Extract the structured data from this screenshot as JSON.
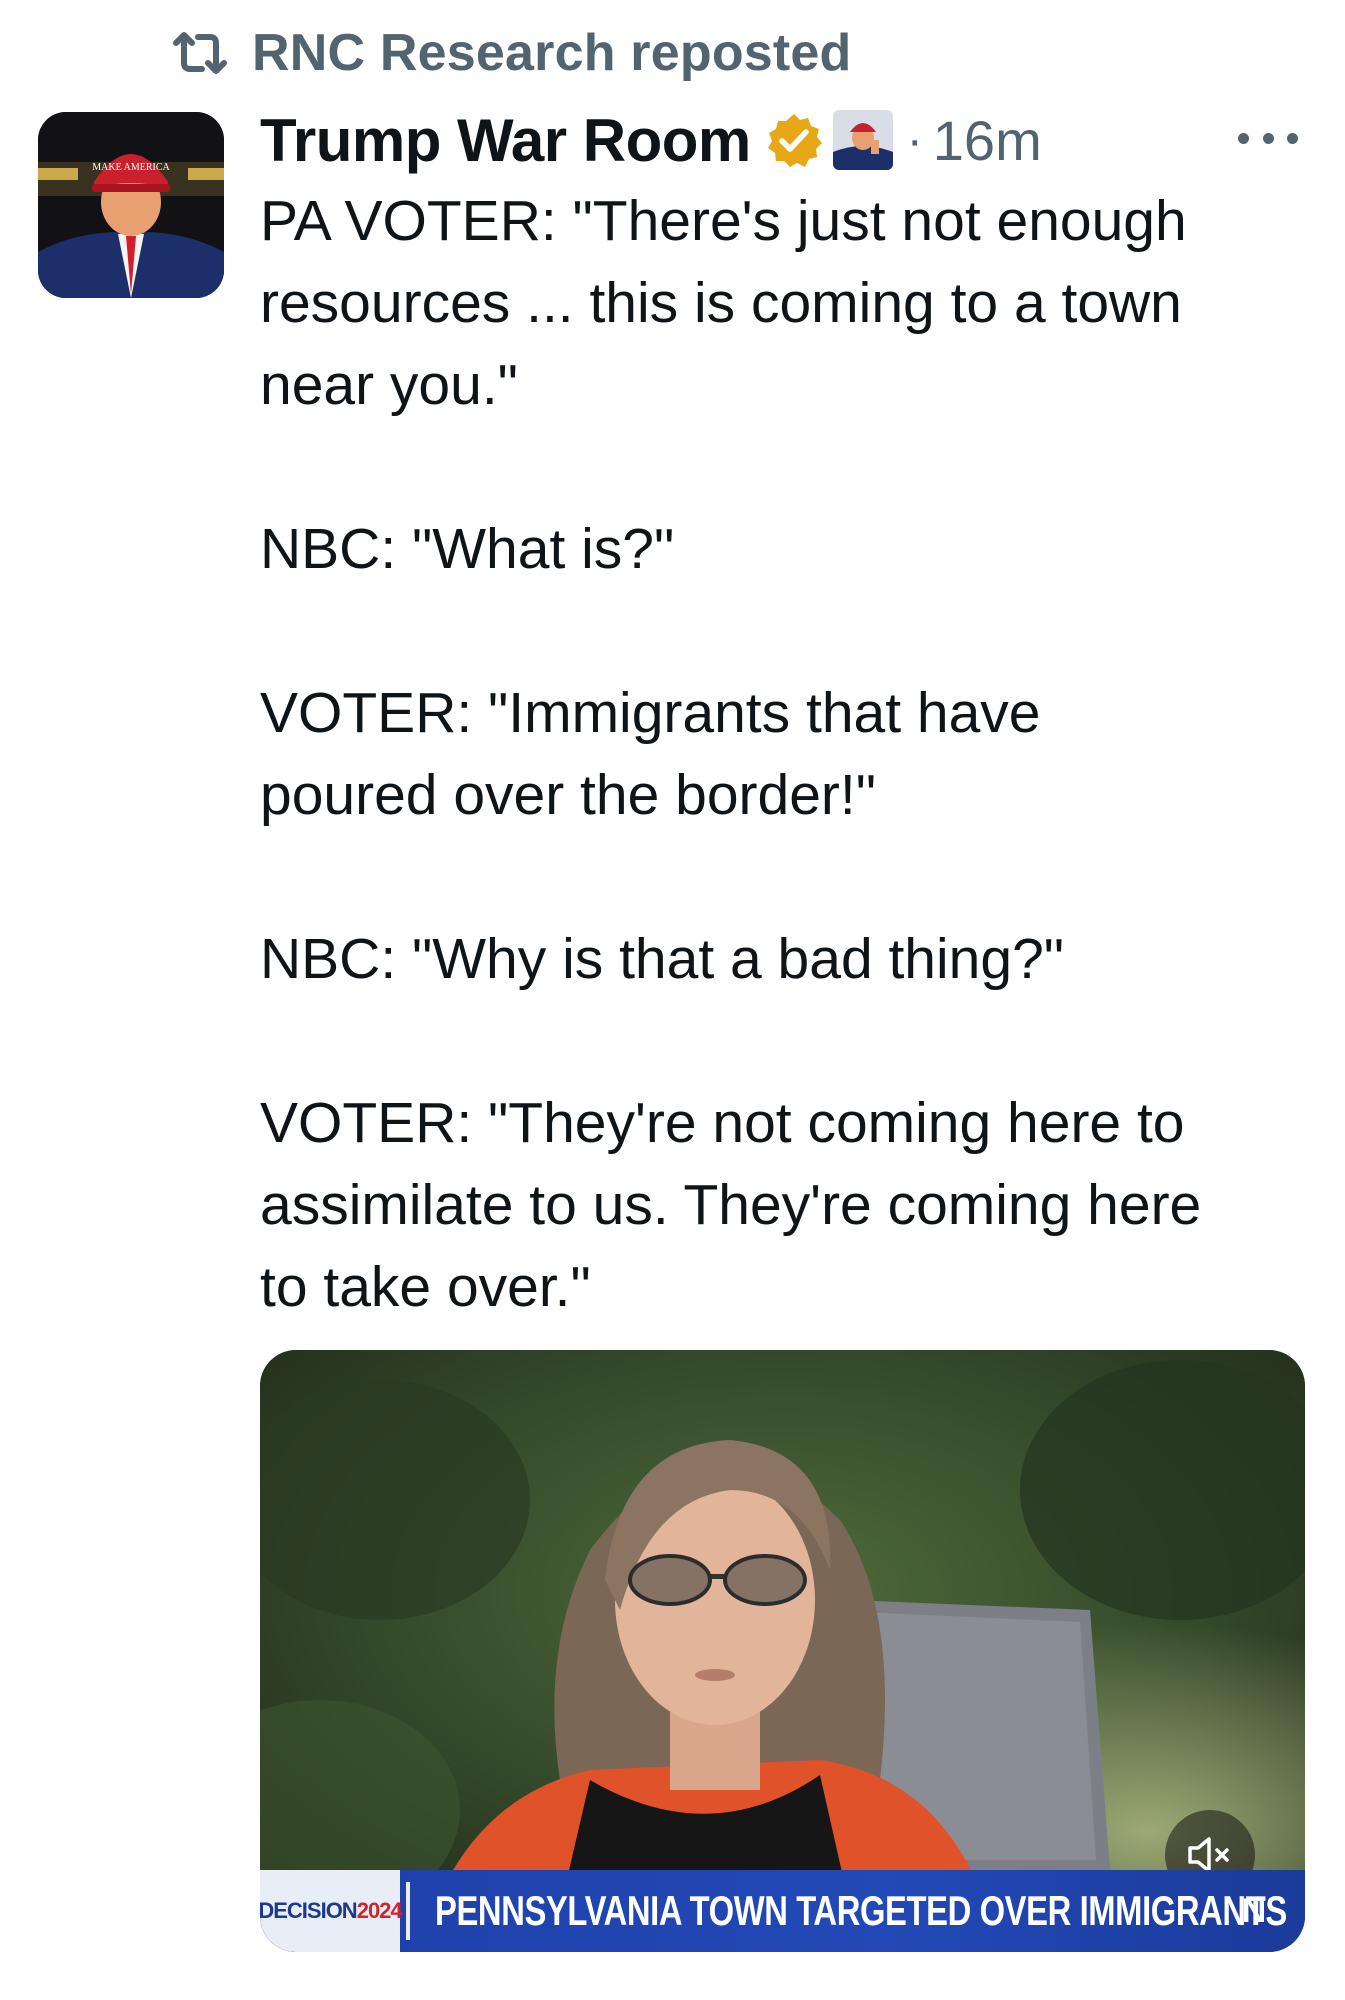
{
  "repost": {
    "icon": "repost-icon",
    "text": "RNC Research reposted"
  },
  "author": {
    "display_name": "Trump War Room",
    "verified_badge_color": "#e6a817",
    "timestamp_separator": "·",
    "timestamp": "16m"
  },
  "tweet": {
    "paragraphs": [
      [
        "PA VOTER: \"There's just not enough",
        "resources ... this is coming to a town",
        "near you.\""
      ],
      [
        "NBC: \"What is?\""
      ],
      [
        "VOTER: \"Immigrants that have",
        "poured over the border!\""
      ],
      [
        "NBC: \"Why is that a bad thing?\""
      ],
      [
        "VOTER: \"They're not coming here to",
        "assimilate to us. They're coming here",
        "to take over.\""
      ]
    ]
  },
  "media": {
    "type": "video",
    "muted": true,
    "lower_third": {
      "decision_label": "DECISION",
      "decision_year": "2024",
      "headline": "PENNSYLVANIA TOWN TARGETED OVER IMMIGRANTS",
      "network_logo": "N"
    }
  },
  "colors": {
    "text_primary": "#0f1419",
    "text_secondary": "#536471",
    "lower_third_blue": "#2249b7"
  }
}
